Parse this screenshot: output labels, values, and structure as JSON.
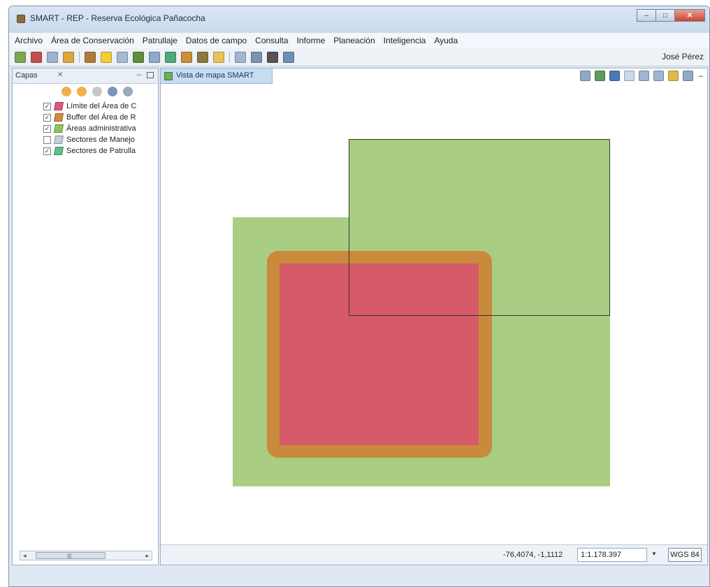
{
  "window": {
    "title": "SMART - REP - Reserva Ecológica Pañacocha",
    "controls": {
      "minimize": "–",
      "maximize": "□",
      "close": "✕"
    }
  },
  "menu": [
    "Archivo",
    "Área de Conservación",
    "Patrullaje",
    "Datos de campo",
    "Consulta",
    "Informe",
    "Planeación",
    "Inteligencia",
    "Ayuda"
  ],
  "toolbar": {
    "user": "José Pérez",
    "icons": [
      {
        "name": "map-icon",
        "color": "#7aa84f"
      },
      {
        "name": "patrol-icon",
        "color": "#c0504d"
      },
      {
        "name": "form-icon",
        "color": "#9bb3d1"
      },
      {
        "name": "hand-icon",
        "color": "#e0a43c"
      },
      {
        "name": "marker-icon",
        "color": "#b07b35"
      },
      {
        "name": "bulb-icon",
        "color": "#f2cf3a"
      },
      {
        "name": "grid-icon",
        "color": "#a6b9cf"
      },
      {
        "name": "person-icon",
        "color": "#5f8f3e"
      },
      {
        "name": "report-icon",
        "color": "#8ea9c9"
      },
      {
        "name": "globe-icon",
        "color": "#4fa77a"
      },
      {
        "name": "ranger-icon",
        "color": "#c98f3a"
      },
      {
        "name": "team-icon",
        "color": "#8a7a3f"
      },
      {
        "name": "folder-icon",
        "color": "#e6c25a"
      },
      {
        "name": "table-icon",
        "color": "#9fb7d3"
      },
      {
        "name": "export-icon",
        "color": "#7c93b0"
      },
      {
        "name": "dropdown-icon",
        "color": "#555555"
      },
      {
        "name": "sync-icon",
        "color": "#6e8fb3"
      }
    ]
  },
  "layers_panel": {
    "title": "Capas",
    "close": "✕",
    "minimize": "–",
    "tools": [
      {
        "name": "move-up-icon",
        "color": "#f1b04c"
      },
      {
        "name": "move-down-icon",
        "color": "#f1b04c"
      },
      {
        "name": "arrow-right-icon",
        "color": "#c7c7c7"
      },
      {
        "name": "edit-layer-icon",
        "color": "#7b95b8"
      },
      {
        "name": "style-icon",
        "color": "#9aa9bd"
      }
    ],
    "layers": [
      {
        "label": "Límite del Área de C",
        "checked": true,
        "color": "#e2577a"
      },
      {
        "label": "Buffer del Área de R",
        "checked": true,
        "color": "#d9893a"
      },
      {
        "label": "Áreas administrativa",
        "checked": true,
        "color": "#8fc65a"
      },
      {
        "label": "Sectores de Manejo",
        "checked": false,
        "color": "#c4cfdb"
      },
      {
        "label": "Sectores de Patrulla",
        "checked": true,
        "color": "#5cbf8a"
      }
    ],
    "scroll_grip": "|||",
    "scroll_left": "◂",
    "scroll_right": "▸"
  },
  "map": {
    "tab_label": "Vista de mapa SMART",
    "tools": [
      {
        "name": "layers-icon",
        "color": "#8fa9c6"
      },
      {
        "name": "refresh-icon",
        "color": "#5b9b5b"
      },
      {
        "name": "pan-icon",
        "color": "#4a78b8"
      },
      {
        "name": "zoom-box-icon",
        "color": "#c9d8ea"
      },
      {
        "name": "zoom-in-icon",
        "color": "#9db5d2"
      },
      {
        "name": "zoom-out-icon",
        "color": "#9db5d2"
      },
      {
        "name": "full-extent-icon",
        "color": "#e1b84a"
      },
      {
        "name": "identify-icon",
        "color": "#8fa9c6"
      }
    ],
    "minimize": "–",
    "coords": "-76,4074, -1,1112",
    "scale": "1:1.178.397",
    "scale_arrow": "▼",
    "crs": "WGS 84",
    "colors": {
      "green": "#a9cd82",
      "orange": "#c98a3c",
      "red": "#d75a68",
      "outline": "#2f3a24"
    }
  }
}
